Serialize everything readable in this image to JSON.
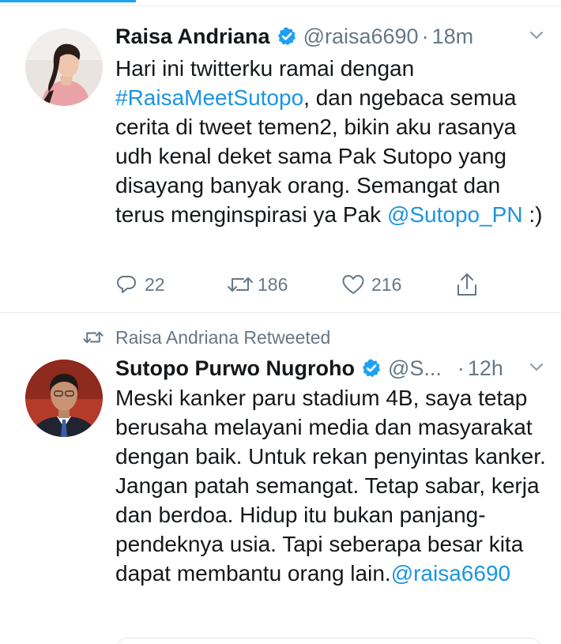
{
  "theme": {
    "link_color": "#1b95e0",
    "muted_color": "#657786",
    "accent_color": "#1da1f2",
    "verified_color": "#1da1f2"
  },
  "tweets": [
    {
      "display_name": "Raisa Andriana",
      "verified": true,
      "handle": "@raisa6690",
      "separator": "·",
      "time": "18m",
      "avatar": "woman-portrait-avatar",
      "text_segments": [
        {
          "text": "Hari ini twitterku ramai dengan ",
          "link": false
        },
        {
          "text": "#RaisaMeetSutopo",
          "link": true
        },
        {
          "text": ", dan ngebaca semua cerita di tweet temen2, bikin aku rasanya udh kenal deket sama Pak Sutopo yang disayang banyak orang. Semangat dan terus menginspirasi ya Pak ",
          "link": false
        },
        {
          "text": "@Sutopo_PN",
          "link": true
        },
        {
          "text": " :)",
          "link": false
        }
      ],
      "reply_count": "22",
      "retweet_count": "186",
      "like_count": "216"
    },
    {
      "retweet_context": "Raisa Andriana Retweeted",
      "display_name": "Sutopo Purwo Nugroho",
      "verified": true,
      "handle": "@S...",
      "separator": "·",
      "time": "12h",
      "avatar": "man-portrait-avatar",
      "text_segments": [
        {
          "text": "Meski kanker paru stadium 4B, saya tetap berusaha melayani media dan masyarakat dengan baik. Untuk rekan penyintas kanker. Jangan patah semangat. Tetap sabar, kerja dan berdoa. Hidup itu bukan panjang-pendeknya usia. Tapi  seberapa besar kita dapat membantu orang lain.",
          "link": false
        },
        {
          "text": "@raisa6690",
          "link": true
        }
      ]
    }
  ],
  "icons": {
    "reply": "reply-icon",
    "retweet": "retweet-icon",
    "like": "heart-icon",
    "share": "share-icon",
    "caret": "chevron-down-icon",
    "verified": "verified-badge-icon"
  }
}
